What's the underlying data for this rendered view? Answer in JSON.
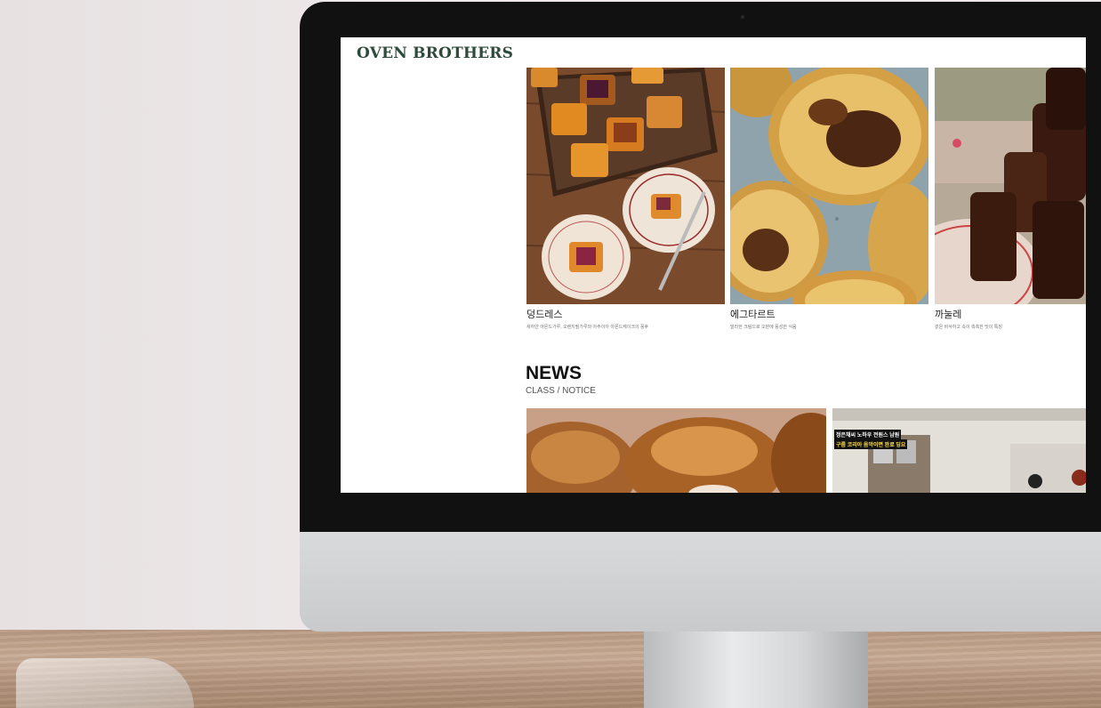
{
  "site": {
    "logo": "OVEN BROTHERS"
  },
  "products": [
    {
      "title": "덩드레스",
      "description": "새하얀 아몬드가루, 오렌지필가루와 아주이아 아몬드케이크의 풍후"
    },
    {
      "title": "에그타르트",
      "description": "말라한 크림으로 오븐에 풍성한 식음"
    },
    {
      "title": "까눌레",
      "description": "겉은 바삭하고 속이 촉촉한 맛이 특징"
    }
  ],
  "news": {
    "heading": "NEWS",
    "subheading": "CLASS / NOTICE",
    "caption_line1": "정은채씨 노하우 전원스 남원",
    "caption_line2": "구름 코리아 음악이면 완료 딩요"
  },
  "colors": {
    "logo": "#2d4a3b",
    "bezel": "#111111"
  }
}
